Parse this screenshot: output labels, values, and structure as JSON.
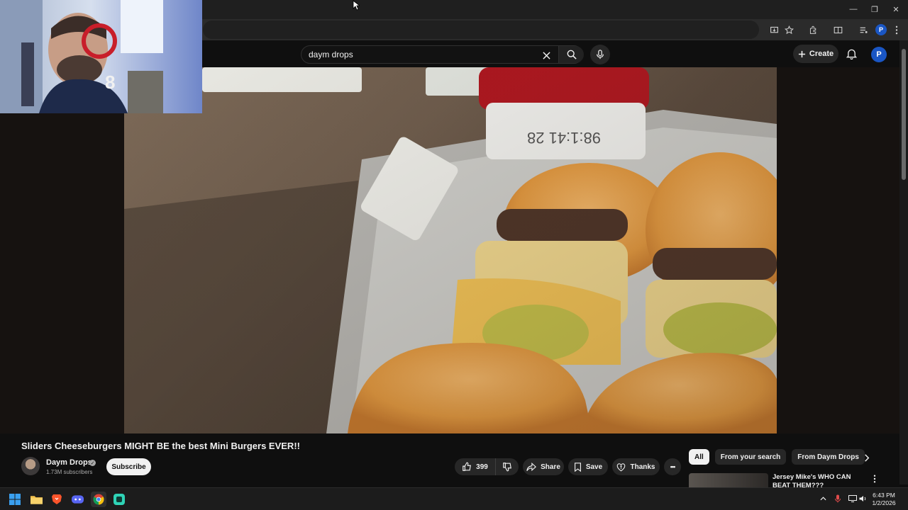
{
  "browser": {
    "window_controls": {
      "minimize": "—",
      "restore": "❐",
      "close": "✕"
    },
    "profile_initial": "P"
  },
  "yt_header": {
    "search_value": "daym drops",
    "create_label": "Create",
    "avatar_initial": "P"
  },
  "video": {
    "title": "Sliders Cheeseburgers MIGHT BE the best Mini Burgers EVER!!",
    "channel_name": "Daym Drops",
    "subscribers": "1.73M subscribers",
    "subscribe_label": "Subscribe",
    "like_count": "399",
    "share_label": "Share",
    "save_label": "Save",
    "thanks_label": "Thanks",
    "more_label": "•••"
  },
  "chips": [
    {
      "label": "All",
      "active": true
    },
    {
      "label": "From your search",
      "active": false
    },
    {
      "label": "From Daym Drops",
      "active": false
    }
  ],
  "recommendation": {
    "title": "Jersey Mike's WHO CAN BEAT THEM???"
  },
  "taskbar": {
    "apps": [
      "windows-start",
      "file-explorer",
      "brave",
      "discord",
      "chrome",
      "app"
    ],
    "time": "6:43 PM",
    "date": "1/2/2026"
  },
  "colors": {
    "background": "#0f0f0f",
    "surface": "#272727",
    "text": "#f1f1f1",
    "muted": "#aaaaaa",
    "profile_blue": "#1a56c4"
  }
}
